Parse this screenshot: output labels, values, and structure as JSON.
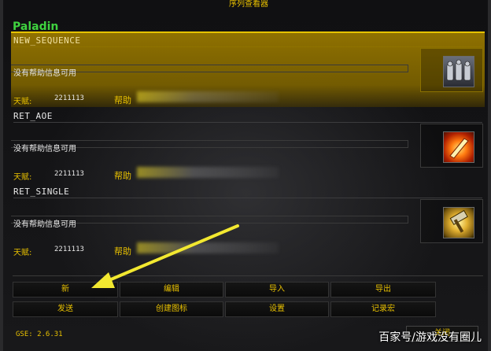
{
  "window": {
    "title": "序列查看器"
  },
  "class_name": "Paladin",
  "sequences": [
    {
      "name": "NEW_SEQUENCE",
      "help": "没有帮助信息可用",
      "talent_label": "天赋:",
      "talent_value": "2211113",
      "help_url_label": "帮助",
      "icon": "paladin-knights-icon",
      "selected": true
    },
    {
      "name": "RET_AOE",
      "help": "没有帮助信息可用",
      "talent_label": "天赋:",
      "talent_value": "2211113",
      "help_url_label": "帮助",
      "icon": "flaming-blade-icon",
      "selected": false
    },
    {
      "name": "RET_SINGLE",
      "help": "没有帮助信息可用",
      "talent_label": "天赋:",
      "talent_value": "2211113",
      "help_url_label": "帮助",
      "icon": "holy-hammer-icon",
      "selected": false
    }
  ],
  "buttons": {
    "new": "新",
    "edit": "编辑",
    "import": "导入",
    "export": "导出",
    "send": "发送",
    "create_icon": "创建图标",
    "settings": "设置",
    "record_macro": "记录宏"
  },
  "version": "GSE: 2.6.31",
  "close_button": "关闭",
  "watermark": "百家号/游戏没有圈儿",
  "colors": {
    "accent": "#e8c000",
    "class_green": "#3fd23f",
    "selected_bg": "#967600"
  }
}
